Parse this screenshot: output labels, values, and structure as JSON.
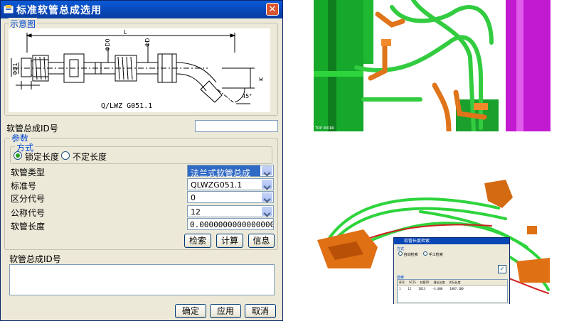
{
  "dialog": {
    "title": "标准软管总成选用",
    "close_symbol": "✕",
    "diagram_group": "示意图",
    "diagram": {
      "dim_L": "L",
      "dim_d1": "ΦD1",
      "dim_d0": "ΦD0",
      "dim_d2": "ΦD",
      "dim_k": "K",
      "dim_angle": "45°",
      "caption": "Q/LWZ G051.1"
    },
    "id_label": "软管总成ID号",
    "id_value": "",
    "params_group": "参数",
    "mode_group": "方式",
    "mode_fixed": "锁定长度",
    "mode_variable": "不定长度",
    "fields": [
      {
        "label": "软管类型",
        "value": "法兰式软管总成"
      },
      {
        "label": "标准号",
        "value": "QLWZG051.1"
      },
      {
        "label": "区分代号",
        "value": "0"
      },
      {
        "label": "公称代号",
        "value": "12"
      }
    ],
    "length_label": "软管长度",
    "length_value": "0.0000000000000000",
    "buttons": {
      "search": "检索",
      "calc": "计算",
      "info": "信息",
      "ok": "确定",
      "apply": "应用",
      "cancel": "取消"
    },
    "result_label": "软管总成ID号"
  },
  "thumbnail": {
    "title": "软管长度检索",
    "mode_group": "方式",
    "opt1": "自动检索",
    "opt2": "手工检索",
    "result_group": "检索",
    "headers": [
      "序号",
      "SCIS",
      "软管ID",
      "理论长度",
      "实际长度"
    ],
    "row": [
      "1",
      "12",
      "1813",
      "-4.000",
      "1087.100"
    ]
  },
  "logo_text": "TOP WORK",
  "colors": {
    "title_blue": "#0845b5",
    "accent_blue": "#0046d5",
    "pipe_green": "#21c531",
    "part_orange": "#e07014",
    "magenta": "#c21ad0"
  }
}
